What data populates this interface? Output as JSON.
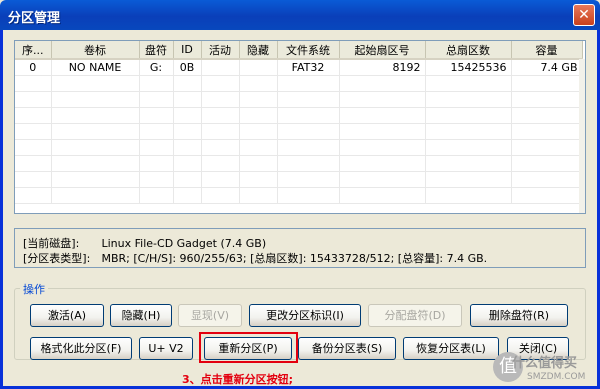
{
  "window": {
    "title": "分区管理",
    "close_icon": "close-icon"
  },
  "table": {
    "columns": [
      "序...",
      "卷标",
      "盘符",
      "ID",
      "活动",
      "隐藏",
      "文件系统",
      "起始扇区号",
      "总扇区数",
      "容量"
    ],
    "rows": [
      [
        "0",
        "NO NAME",
        "G:",
        "0B",
        "",
        "",
        "FAT32",
        "8192",
        "15425536",
        "7.4 GB"
      ]
    ]
  },
  "info": {
    "current_disk_label": "[当前磁盘]:",
    "current_disk_value": "Linux File-CD Gadget (7.4 GB)",
    "table_type_label": "[分区表类型]:",
    "table_type_value": "MBR;    [C/H/S]: 960/255/63; [总扇区数]: 15433728/512; [总容量]: 7.4 GB."
  },
  "operations": {
    "group_label": "操作",
    "row1": {
      "activate": "激活(A)",
      "hide": "隐藏(H)",
      "show": "显现(V)",
      "change_id": "更改分区标识(I)",
      "assign_letter": "分配盘符(D)",
      "remove_letter": "删除盘符(R)"
    },
    "row2": {
      "format": "格式化此分区(F)",
      "uv2": "U+ V2",
      "repartition": "重新分区(P)",
      "backup": "备份分区表(S)",
      "restore": "恢复分区表(L)",
      "close": "关闭(C)"
    }
  },
  "annotation": "3、点击重新分区按钮;",
  "watermark": {
    "glyph": "值",
    "text": "什么值得买",
    "site": "SMZDM.COM"
  }
}
